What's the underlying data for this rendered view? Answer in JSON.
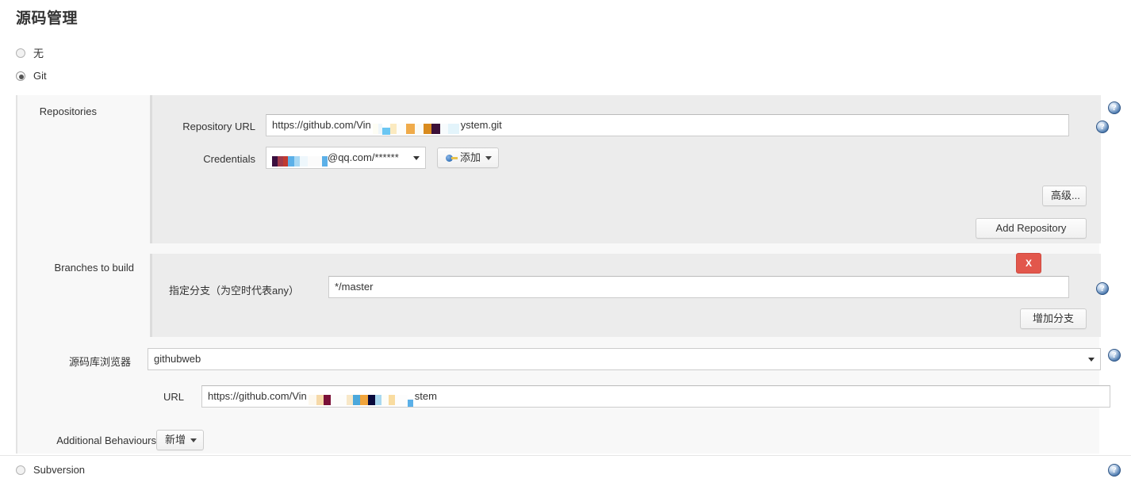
{
  "page": {
    "title": "源码管理"
  },
  "scm_options": [
    {
      "label": "无",
      "checked": false,
      "name": "none"
    },
    {
      "label": "Git",
      "checked": true,
      "name": "git"
    },
    {
      "label": "Subversion",
      "checked": false,
      "name": "subversion"
    }
  ],
  "git": {
    "repositories": {
      "label": "Repositories",
      "repository_url": {
        "label": "Repository URL",
        "value_prefix": "https://github.com/Vin",
        "value_suffix": "ystem.git",
        "redacted": true
      },
      "credentials": {
        "label": "Credentials",
        "value_suffix": "@qq.com/******",
        "redacted": true,
        "add_button": "添加"
      },
      "advanced_button": "高级...",
      "add_repository_button": "Add Repository"
    },
    "branches": {
      "label": "Branches to build",
      "branch_spec": {
        "label": "指定分支（为空时代表any）",
        "value": "*/master"
      },
      "delete_button": "X",
      "add_branch_button": "增加分支"
    },
    "repo_browser": {
      "label": "源码库浏览器",
      "value": "githubweb",
      "url": {
        "label": "URL",
        "value_prefix": "https://github.com/Vin",
        "value_suffix": "stem",
        "redacted": true
      }
    },
    "additional_behaviours": {
      "label": "Additional Behaviours",
      "add_button": "新增"
    }
  },
  "help_icon_glyph": "?",
  "colors": {
    "panel_bg": "#f8f8f8",
    "nested_bg": "#ececec",
    "delete_red": "#e2574c",
    "help_blue": "#4a78ad"
  }
}
